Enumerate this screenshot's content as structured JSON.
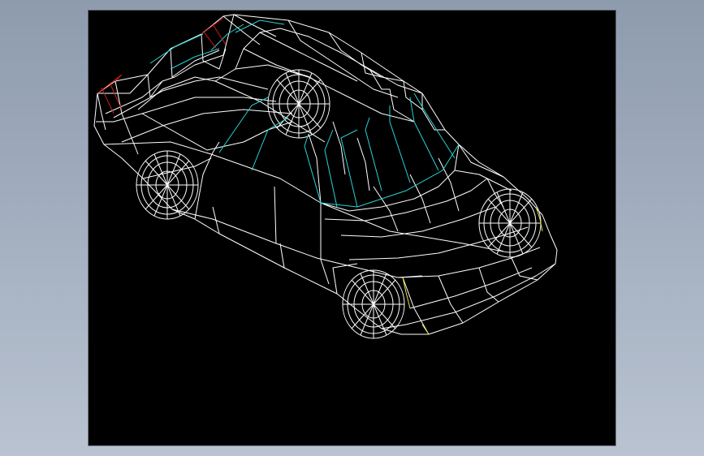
{
  "app_background": {
    "gradient_top": "#8e9bae",
    "gradient_bottom": "#b9c3d1"
  },
  "viewport": {
    "background": "#000000",
    "model": "car-wireframe",
    "view": "isometric"
  },
  "line_colors": {
    "body": "#ffffff",
    "glass": "#29d3d3",
    "roof_edge": "#d01c1c",
    "headlight_edge": "#e7e23a"
  }
}
